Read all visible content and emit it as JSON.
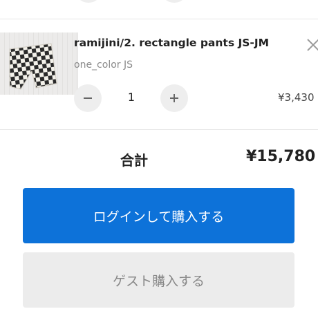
{
  "cart": {
    "item": {
      "title": "ramijini/2. rectangle pants JS-JM",
      "variant": "one_color JS",
      "quantity": "1",
      "price": "¥3,430",
      "thumbnail_icon": "checkered-pants-image",
      "remove_icon": "close-icon",
      "decrease_icon": "minus-icon",
      "increase_icon": "plus-icon"
    },
    "total": {
      "label": "合計",
      "value": "¥15,780"
    },
    "actions": {
      "login_checkout_label": "ログインして購入する",
      "guest_checkout_label": "ゲスト購入する"
    }
  },
  "colors": {
    "primary": "#0d72d9",
    "secondary_bg": "#ececec",
    "secondary_text": "#888888",
    "muted_text": "#8a8a8a"
  }
}
